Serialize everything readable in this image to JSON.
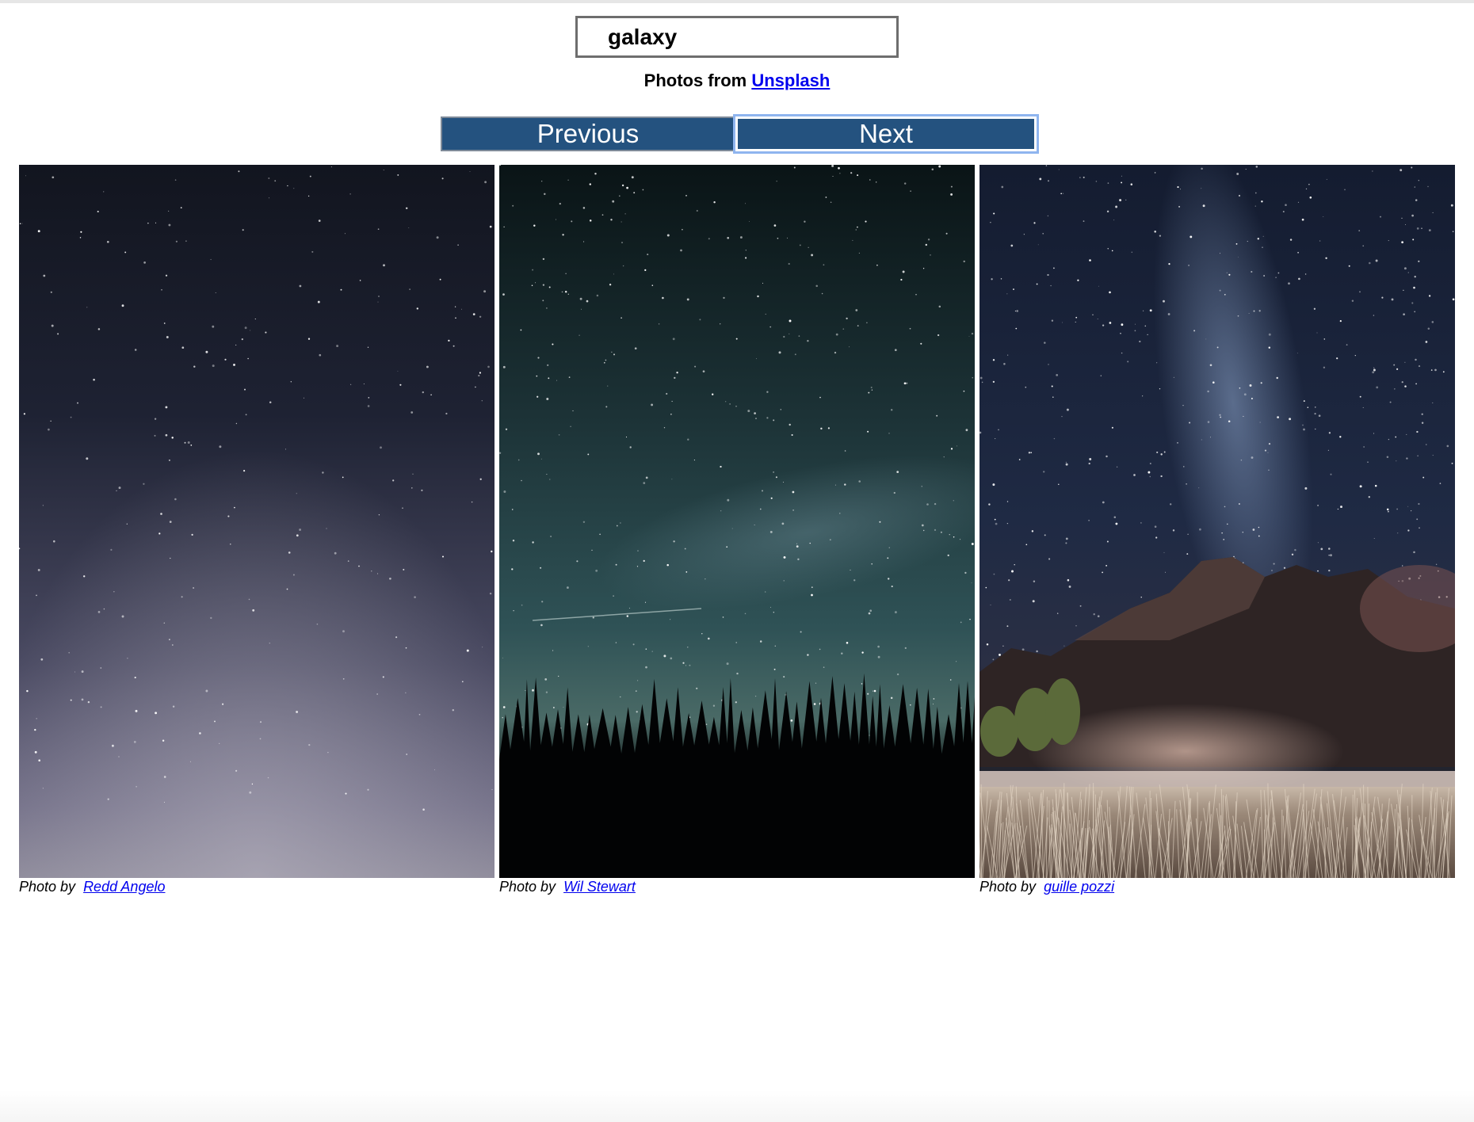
{
  "search": {
    "value": "galaxy"
  },
  "attribution": {
    "prefix": "Photos from ",
    "link_label": "Unsplash"
  },
  "pager": {
    "previous_label": "Previous",
    "next_label": "Next"
  },
  "photos": [
    {
      "caption_prefix": "Photo by  ",
      "author": "Redd Angelo",
      "scene": "starry-night-sky"
    },
    {
      "caption_prefix": "Photo by  ",
      "author": "Wil Stewart",
      "scene": "night-sky-over-forest"
    },
    {
      "caption_prefix": "Photo by  ",
      "author": "guille pozzi",
      "scene": "milky-way-over-mountain-field"
    }
  ]
}
